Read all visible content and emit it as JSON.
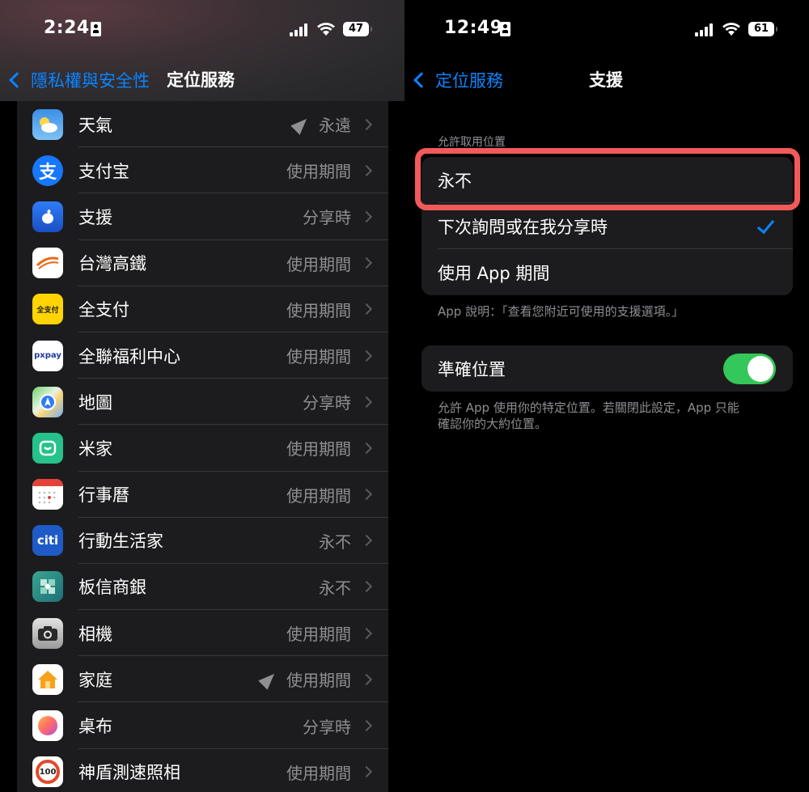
{
  "colors": {
    "accent": "#0a84ff",
    "toggle_on": "#34c759",
    "highlight": "#f25a5a"
  },
  "left": {
    "status": {
      "time": "2:24",
      "battery": "47"
    },
    "nav": {
      "back_label": "隱私權與安全性",
      "title": "定位服務"
    },
    "apps": [
      {
        "name": "天氣",
        "value": "永遠",
        "arrow": true,
        "icon": "weather-icon"
      },
      {
        "name": "支付宝",
        "value": "使用期間",
        "arrow": false,
        "icon": "alipay-icon"
      },
      {
        "name": "支援",
        "value": "分享時",
        "arrow": false,
        "icon": "apple-support-icon"
      },
      {
        "name": "台灣高鐵",
        "value": "使用期間",
        "arrow": false,
        "icon": "thsr-icon"
      },
      {
        "name": "全支付",
        "value": "使用期間",
        "arrow": false,
        "icon": "pxpay-plus-icon"
      },
      {
        "name": "全聯福利中心",
        "value": "使用期間",
        "arrow": false,
        "icon": "pxmart-icon"
      },
      {
        "name": "地圖",
        "value": "分享時",
        "arrow": false,
        "icon": "maps-icon"
      },
      {
        "name": "米家",
        "value": "使用期間",
        "arrow": false,
        "icon": "mihome-icon"
      },
      {
        "name": "行事曆",
        "value": "使用期間",
        "arrow": false,
        "icon": "calendar-icon"
      },
      {
        "name": "行動生活家",
        "value": "永不",
        "arrow": false,
        "icon": "citi-icon"
      },
      {
        "name": "板信商銀",
        "value": "永不",
        "arrow": false,
        "icon": "bop-bank-icon"
      },
      {
        "name": "相機",
        "value": "使用期間",
        "arrow": false,
        "icon": "camera-icon"
      },
      {
        "name": "家庭",
        "value": "使用期間",
        "arrow": true,
        "icon": "home-icon"
      },
      {
        "name": "桌布",
        "value": "分享時",
        "arrow": false,
        "icon": "wallpaper-icon"
      },
      {
        "name": "神盾測速照相",
        "value": "使用期間",
        "arrow": false,
        "icon": "speed-camera-icon"
      }
    ],
    "icon_texts": {
      "alipay": "支",
      "pxpay_plus": "全支付",
      "pxmart": "pxpay",
      "citi": "citi",
      "speed": "100"
    }
  },
  "right": {
    "status": {
      "time": "12:49",
      "battery": "61"
    },
    "nav": {
      "back_label": "定位服務",
      "title": "支援"
    },
    "section_header": "允許取用位置",
    "options": [
      {
        "label": "永不",
        "checked": false
      },
      {
        "label": "下次詢問或在我分享時",
        "checked": true
      },
      {
        "label": "使用 App 期間",
        "checked": false
      }
    ],
    "app_description": "App 說明：「查看您附近可使用的支援選項。」",
    "precise": {
      "label": "準確位置",
      "on": true
    },
    "precise_footer_line1": "允許 App 使用你的特定位置。若關閉此設定，App 只能",
    "precise_footer_line2": "確認你的大約位置。"
  }
}
